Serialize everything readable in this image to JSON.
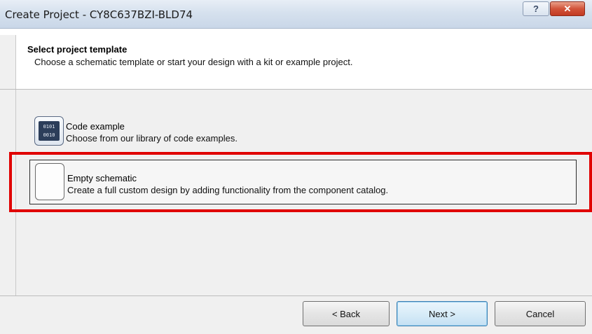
{
  "window": {
    "title": "Create Project - CY8C637BZI-BLD74",
    "help_glyph": "?",
    "close_glyph": "✕"
  },
  "header": {
    "title": "Select project template",
    "subtitle": "Choose a schematic template or start your design with a kit or example project."
  },
  "options": [
    {
      "title": "Code example",
      "description": "Choose from our library of code examples.",
      "icon": "binary-code-icon",
      "icon_text": [
        "0101",
        "0010"
      ]
    },
    {
      "title": "Empty schematic",
      "description": "Create a full custom design by adding functionality from the component catalog.",
      "icon": "blank-schematic-icon",
      "selected": true
    }
  ],
  "buttons": {
    "back": "< Back",
    "next": "Next >",
    "cancel": "Cancel"
  },
  "colors": {
    "highlight": "#e00000",
    "titlebar": "#d6e1ee",
    "close_button": "#c23a22"
  }
}
